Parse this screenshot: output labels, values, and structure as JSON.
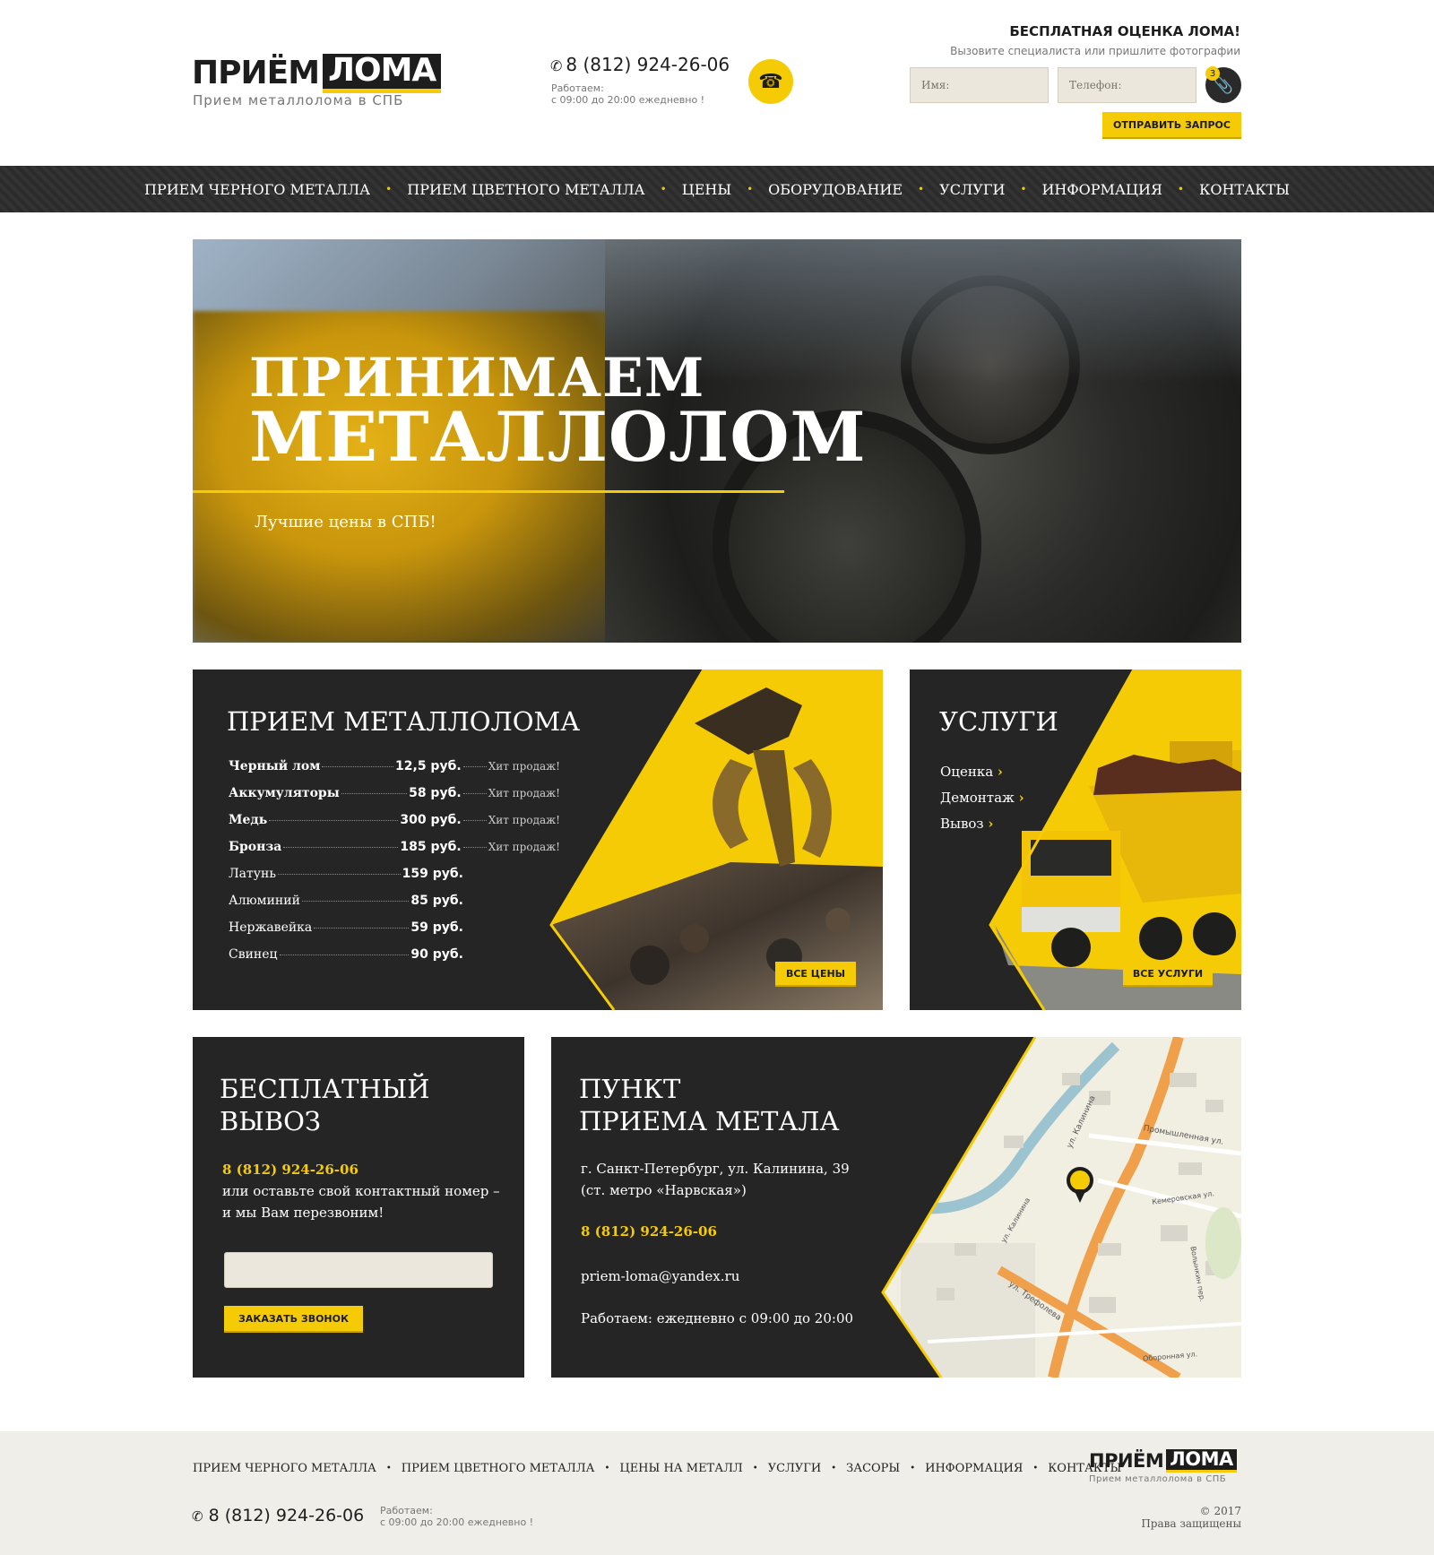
{
  "header": {
    "logo_left": "ПРИЁМ",
    "logo_right": "ЛОМА",
    "logo_tagline": "Прием металлолома в СПБ",
    "phone": "8 (812) 924-26-06",
    "hours_line1": "Работаем:",
    "hours_line2": "с 09:00 до 20:00 ежедневно !",
    "free_title": "БЕСПЛАТНАЯ ОЦЕНКА ЛОМА!",
    "free_subtitle": "Вызовите специалиста или пришлите фотографии",
    "name_placeholder": "Имя:",
    "phone_placeholder": "Телефон:",
    "attach_count": "3",
    "send_button": "ОТПРАВИТЬ ЗАПРОС"
  },
  "nav": {
    "items": [
      "ПРИЕМ ЧЕРНОГО МЕТАЛЛА",
      "ПРИЕМ ЦВЕТНОГО МЕТАЛЛА",
      "ЦЕНЫ",
      "ОБОРУДОВАНИЕ",
      "УСЛУГИ",
      "ИНФОРМАЦИЯ",
      "КОНТАКТЫ"
    ]
  },
  "hero": {
    "line1": "ПРИНИМАЕМ",
    "line2": "МЕТАЛЛОЛОМ",
    "subtitle": "Лучшие цены в СПБ!"
  },
  "prices": {
    "title": "ПРИЕМ МЕТАЛЛОЛОМА",
    "rows": [
      {
        "name": "Черный лом",
        "price": "12,5 руб.",
        "hit": "Хит продаж!"
      },
      {
        "name": "Аккумуляторы",
        "price": "58 руб.",
        "hit": "Хит продаж!"
      },
      {
        "name": "Медь",
        "price": "300 руб.",
        "hit": "Хит продаж!"
      },
      {
        "name": "Бронза",
        "price": "185 руб.",
        "hit": "Хит продаж!"
      },
      {
        "name": "Латунь",
        "price": "159 руб.",
        "hit": ""
      },
      {
        "name": "Алюминий",
        "price": "85 руб.",
        "hit": ""
      },
      {
        "name": "Нержавейка",
        "price": "59 руб.",
        "hit": ""
      },
      {
        "name": "Свинец",
        "price": "90 руб.",
        "hit": ""
      }
    ],
    "all_button": "ВСЕ ЦЕНЫ"
  },
  "services": {
    "title": "УСЛУГИ",
    "items": [
      "Оценка",
      "Демонтаж",
      "Вывоз"
    ],
    "all_button": "ВСЕ УСЛУГИ"
  },
  "pickup": {
    "title_line1": "БЕСПЛАТНЫЙ",
    "title_line2": "ВЫВОЗ",
    "phone": "8 (812) 924-26-06",
    "text_line1": "или оставьте свой контактный номер –",
    "text_line2": "и мы Вам перезвоним!",
    "input_value": "",
    "button": "ЗАКАЗАТЬ ЗВОНОК"
  },
  "point": {
    "title_line1": "ПУНКТ",
    "title_line2": "ПРИЕМА МЕТАЛА",
    "address_line1": "г. Санкт-Петербург, ул. Калинина, 39",
    "address_line2": "(ст. метро «Нарвская»)",
    "phone": "8 (812) 924-26-06",
    "email": "priem-loma@yandex.ru",
    "hours": "Работаем: ежедневно с 09:00 до 20:00",
    "map_labels": [
      "ул. Калинина",
      "Промышленная ул.",
      "Кемеровская ул.",
      "ул. Трефолева",
      "Волынкин пер.",
      "Оборонная ул.",
      "ул. Калинина"
    ]
  },
  "footer": {
    "nav_items": [
      "ПРИЕМ ЧЕРНОГО МЕТАЛЛА",
      "ПРИЕМ ЦВЕТНОГО МЕТАЛЛА",
      "ЦЕНЫ НА МЕТАЛЛ",
      "УСЛУГИ",
      "ЗАСОРЫ",
      "ИНФОРМАЦИЯ",
      "КОНТАКТЫ"
    ],
    "phone": "8 (812) 924-26-06",
    "hours_line1": "Работаем:",
    "hours_line2": "с 09:00 до 20:00 ежедневно !",
    "logo_left": "ПРИЁМ",
    "logo_right": "ЛОМА",
    "logo_tagline": "Прием металлолома в СПБ",
    "copyright_year": "© 2017",
    "copyright_text": "Права защищены"
  },
  "colors": {
    "accent": "#f5cb06",
    "dark": "#252525",
    "footer_bg": "#efeee9"
  }
}
